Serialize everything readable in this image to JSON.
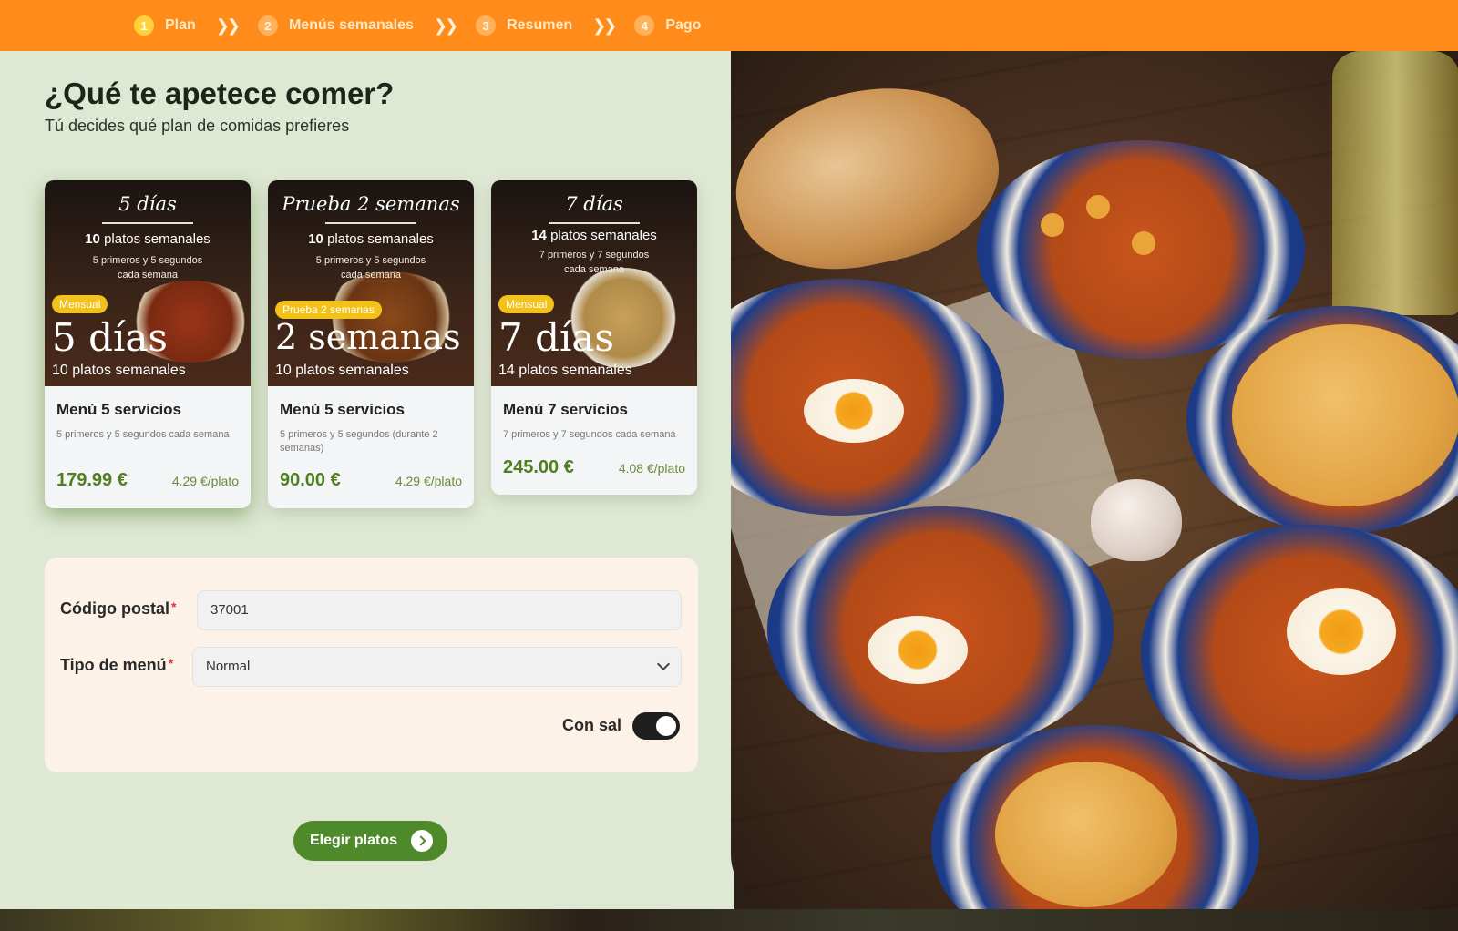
{
  "steps": [
    {
      "num": "1",
      "label": "Plan"
    },
    {
      "num": "2",
      "label": "Menús semanales"
    },
    {
      "num": "3",
      "label": "Resumen"
    },
    {
      "num": "4",
      "label": "Pago"
    }
  ],
  "page": {
    "title": "¿Qué te apetece comer?",
    "subtitle": "Tú decides qué plan de comidas prefieres"
  },
  "plans": [
    {
      "img_title": "5 días",
      "img_line1_count": "10",
      "img_line1_text": "platos semanales",
      "img_line2a": "5 primeros y 5 segundos",
      "img_line2b": "cada semana",
      "badge": "Mensual",
      "big": "5 días",
      "big_sub": "10 platos semanales",
      "name": "Menú 5 servicios",
      "description": "5 primeros y 5 segundos cada semana",
      "price": "179.99 €",
      "per_plate": "4.29 €/plato",
      "selected": true
    },
    {
      "img_title": "Prueba 2 semanas",
      "img_line1_count": "10",
      "img_line1_text": "platos semanales",
      "img_line2a": "5 primeros y 5 segundos",
      "img_line2b": "cada semana",
      "badge": "Prueba 2 semanas",
      "big": "2 semanas",
      "big_sub": "10 platos semanales",
      "name": "Menú 5 servicios",
      "description": "5 primeros y 5 segundos (durante 2 semanas)",
      "price": "90.00 €",
      "per_plate": "4.29 €/plato",
      "selected": false
    },
    {
      "img_title": "7 días",
      "img_line1_count": "14",
      "img_line1_text": "platos semanales",
      "img_line2a": "7 primeros y 7 segundos",
      "img_line2b": "cada semana",
      "badge": "Mensual",
      "big": "7 días",
      "big_sub": "14 platos semanales",
      "name": "Menú 7 servicios",
      "description": "7 primeros y 7 segundos cada semana",
      "price": "245.00 €",
      "per_plate": "4.08 €/plato",
      "selected": false
    }
  ],
  "form": {
    "postal_label": "Código postal",
    "postal_value": "37001",
    "menu_type_label": "Tipo de menú",
    "menu_type_value": "Normal",
    "required_mark": "*",
    "salt_label": "Con sal",
    "salt_on": true
  },
  "cta": {
    "label": "Elegir platos"
  },
  "colors": {
    "topbar": "#ff8c1a",
    "accent_green": "#4e8a2a",
    "badge_yellow": "#f2c21a"
  }
}
